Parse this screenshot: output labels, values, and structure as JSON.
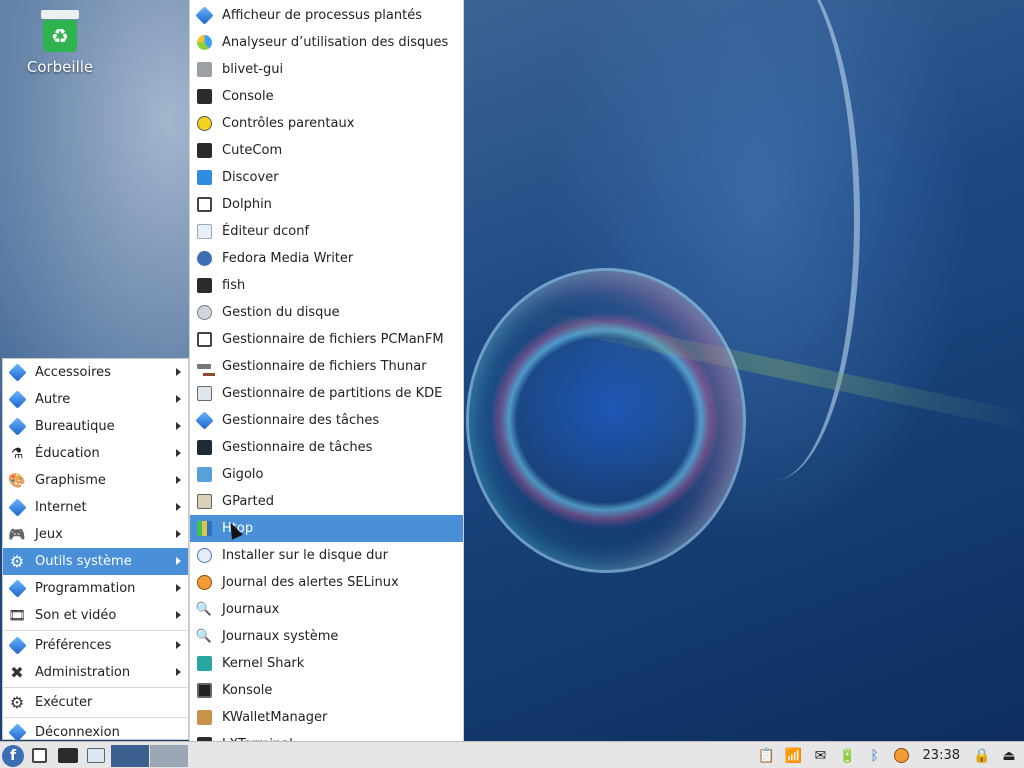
{
  "desktop": {
    "icons": [
      {
        "label": "Corbeille",
        "icon": "trash-icon"
      }
    ]
  },
  "menu": {
    "items": [
      {
        "label": "Accessoires",
        "icon": "diamond-icon",
        "has_submenu": true
      },
      {
        "label": "Autre",
        "icon": "diamond-icon",
        "has_submenu": true
      },
      {
        "label": "Bureautique",
        "icon": "diamond-icon",
        "has_submenu": true
      },
      {
        "label": "Éducation",
        "icon": "flask-icon",
        "has_submenu": true
      },
      {
        "label": "Graphisme",
        "icon": "palette-icon",
        "has_submenu": true
      },
      {
        "label": "Internet",
        "icon": "diamond-icon",
        "has_submenu": true
      },
      {
        "label": "Jeux",
        "icon": "gamepad-icon",
        "has_submenu": true
      },
      {
        "label": "Outils système",
        "icon": "gear-icon",
        "has_submenu": true,
        "active": true
      },
      {
        "label": "Programmation",
        "icon": "diamond-icon",
        "has_submenu": true
      },
      {
        "label": "Son et vidéo",
        "icon": "film-icon",
        "has_submenu": true
      },
      {
        "label": "Préférences",
        "icon": "diamond-icon",
        "has_submenu": true
      },
      {
        "label": "Administration",
        "icon": "tools-icon",
        "has_submenu": true
      },
      {
        "label": "Exécuter",
        "icon": "gear-icon",
        "has_submenu": false
      },
      {
        "label": "Déconnexion",
        "icon": "diamond-icon",
        "has_submenu": false
      }
    ]
  },
  "submenu": {
    "items": [
      {
        "label": "Afficheur de processus plantés",
        "icon": "diamond-icon"
      },
      {
        "label": "Analyseur d’utilisation des disques",
        "icon": "pie-chart-icon"
      },
      {
        "label": "blivet-gui",
        "icon": "disk-icon"
      },
      {
        "label": "Console",
        "icon": "terminal-icon"
      },
      {
        "label": "Contrôles parentaux",
        "icon": "parental-icon"
      },
      {
        "label": "CuteCom",
        "icon": "terminal-icon"
      },
      {
        "label": "Discover",
        "icon": "store-icon"
      },
      {
        "label": "Dolphin",
        "icon": "file-manager-icon"
      },
      {
        "label": "Éditeur dconf",
        "icon": "editor-icon"
      },
      {
        "label": "Fedora Media Writer",
        "icon": "fedora-icon"
      },
      {
        "label": "fish",
        "icon": "terminal-icon"
      },
      {
        "label": "Gestion du disque",
        "icon": "disk-icon"
      },
      {
        "label": "Gestionnaire de fichiers PCManFM",
        "icon": "file-manager-icon"
      },
      {
        "label": "Gestionnaire de fichiers Thunar",
        "icon": "hammer-icon"
      },
      {
        "label": "Gestionnaire de partitions de KDE",
        "icon": "partition-icon"
      },
      {
        "label": "Gestionnaire des tâches",
        "icon": "diamond-icon"
      },
      {
        "label": "Gestionnaire de tâches",
        "icon": "monitor-icon"
      },
      {
        "label": "Gigolo",
        "icon": "network-icon"
      },
      {
        "label": "GParted",
        "icon": "partition-icon"
      },
      {
        "label": "Htop",
        "icon": "htop-icon",
        "active": true
      },
      {
        "label": "Installer sur le disque dur",
        "icon": "install-icon"
      },
      {
        "label": "Journal des alertes SELinux",
        "icon": "selinux-icon"
      },
      {
        "label": "Journaux",
        "icon": "search-icon"
      },
      {
        "label": "Journaux système",
        "icon": "search-icon"
      },
      {
        "label": "Kernel Shark",
        "icon": "shark-icon"
      },
      {
        "label": "Konsole",
        "icon": "terminal-icon"
      },
      {
        "label": "KWalletManager",
        "icon": "wallet-icon"
      },
      {
        "label": "LXTerminal",
        "icon": "terminal-icon"
      }
    ]
  },
  "taskbar": {
    "clock": "23:38"
  },
  "colors": {
    "highlight": "#4a90d9",
    "taskbar_bg": "#e6e6e6"
  }
}
